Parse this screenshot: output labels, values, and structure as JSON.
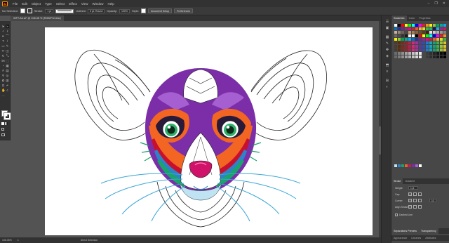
{
  "app": {
    "logo": "Ai"
  },
  "menu": {
    "items": [
      "File",
      "Edit",
      "Object",
      "Type",
      "Select",
      "Effect",
      "View",
      "Window",
      "Help"
    ]
  },
  "window_controls": [
    "–",
    "❐",
    "✕"
  ],
  "control_bar": {
    "selection": "No Selection",
    "stroke_label": "Stroke:",
    "stroke_value": "1 pt",
    "uniform_label": "Uniform",
    "brush_value": "5 pt. Round",
    "opacity_label": "Opacity:",
    "opacity_value": "100%",
    "style_label": "Style:",
    "doc_setup": "Document Setup",
    "preferences": "Preferences"
  },
  "document": {
    "tab": "WFT-A4.ai* @ 106.35 % (RGB/Preview)"
  },
  "status": {
    "zoom": "106.35%",
    "artboard": "1",
    "tool": "Direct Selection"
  },
  "right_panel": {
    "tabs": [
      "Swatches",
      "Color",
      "Properties"
    ],
    "stroke_tabs": [
      "Stroke",
      "Gradient"
    ],
    "weight_label": "Weight:",
    "weight_value": "1 pt",
    "cap_label": "Cap:",
    "corner_label": "Corner:",
    "limit_value": "10",
    "align_label": "Align Stroke:",
    "dashed_label": "Dashed Line",
    "bottom_tabs": [
      "Separations Preview",
      "Transparency"
    ],
    "bottom_tabs2": [
      "Appearance",
      "Libraries",
      "Attributes"
    ]
  },
  "colors": {
    "face_purple": "#7b2ea8",
    "cheek_orange": "#f26522",
    "cheek_blue": "#2e82c9",
    "cheek_green": "#1aa36a",
    "nose_pink": "#d1126a",
    "eye_green": "#2fb06b",
    "whisker_blue": "#3aa7d8"
  }
}
